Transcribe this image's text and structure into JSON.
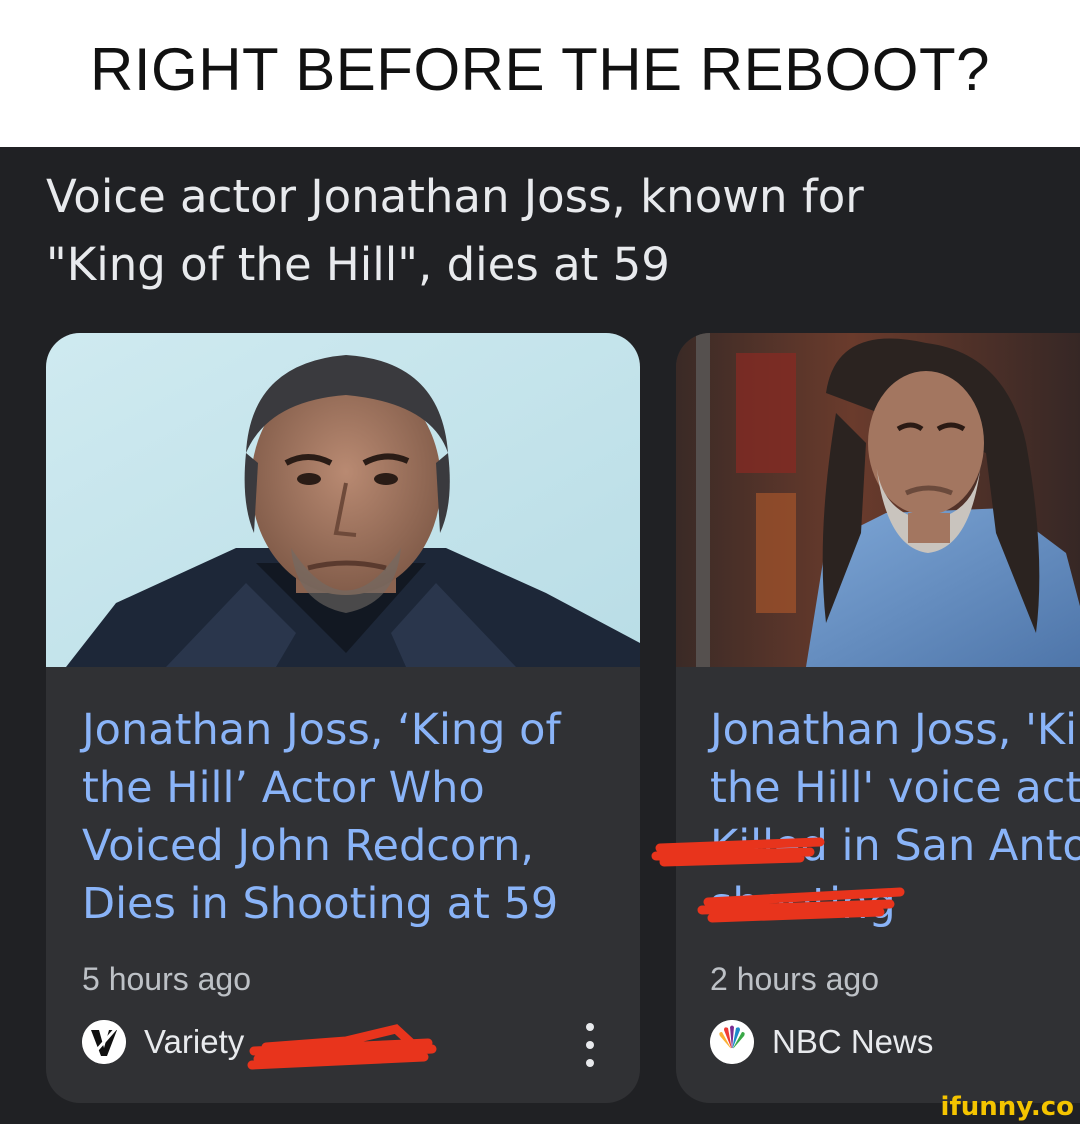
{
  "meme_caption": "RIGHT BEFORE THE REBOOT?",
  "section": {
    "heading_line1": "Voice actor Jonathan Joss, known for",
    "heading_line2": "\"King of the Hill\", dies at 59"
  },
  "cards": [
    {
      "headline_lines": [
        "Jonathan Joss, ‘King of",
        "the Hill’ Actor Who",
        "Voiced John Redcorn,",
        "Dies in Sh",
        "ooting",
        " at 59"
      ],
      "time": "5 hours ago",
      "source": "Variety",
      "source_logo_icon": "variety-logo-icon",
      "more_icon": "more-vert-icon"
    },
    {
      "headline_lines": [
        "Jonathan Joss, 'King of",
        "the Hill' voice actor",
        "Killed",
        " in San Antonio",
        "shooting"
      ],
      "time": "2 hours ago",
      "source": "NBC News",
      "source_logo_icon": "nbc-peacock-logo-icon"
    }
  ],
  "watermark": "ifunny.co",
  "colors": {
    "background": "#202124",
    "card": "#303134",
    "link": "#8ab4f8",
    "text": "#e8eaed",
    "secondary_text": "#bdc1c6",
    "scribble": "#e8341c",
    "watermark": "#f4c400"
  }
}
